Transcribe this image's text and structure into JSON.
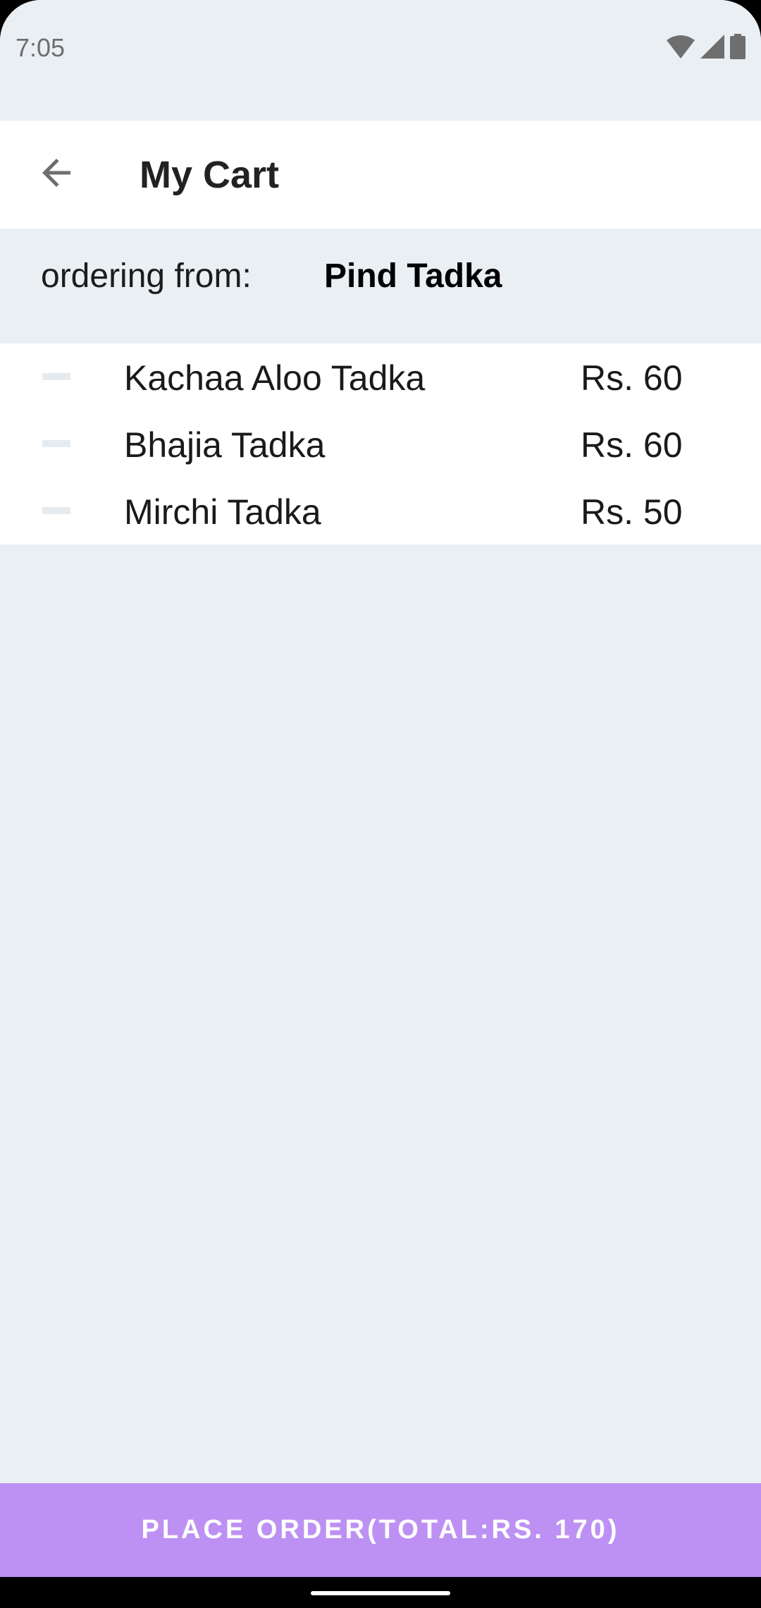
{
  "status_bar": {
    "time": "7:05",
    "icons": [
      "wifi-icon",
      "cellular-signal-icon",
      "battery-icon"
    ]
  },
  "app_bar": {
    "title": "My Cart",
    "back_icon": "arrow-back-icon"
  },
  "ordering": {
    "label": "ordering from:",
    "restaurant": "Pind Tadka"
  },
  "cart": {
    "items": [
      {
        "name": "Kachaa Aloo Tadka",
        "price": "Rs. 60"
      },
      {
        "name": "Bhajia Tadka",
        "price": "Rs. 60"
      },
      {
        "name": "Mirchi Tadka",
        "price": "Rs. 50"
      }
    ]
  },
  "footer": {
    "place_order_label": "PLACE ORDER(TOTAL:RS. 170)"
  },
  "colors": {
    "background": "#eaeff4",
    "surface": "#ffffff",
    "accent": "#bd91f3",
    "nav_bar": "#000000"
  }
}
